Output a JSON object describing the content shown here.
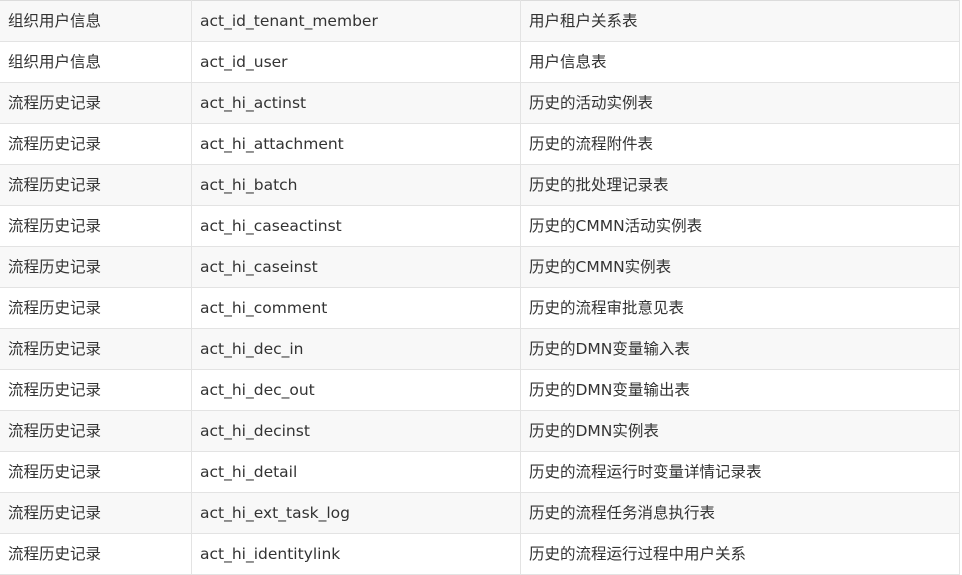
{
  "table": {
    "rows": [
      {
        "category": "组织用户信息",
        "name": "act_id_tenant_member",
        "desc": "用户租户关系表"
      },
      {
        "category": "组织用户信息",
        "name": "act_id_user",
        "desc": "用户信息表"
      },
      {
        "category": "流程历史记录",
        "name": "act_hi_actinst",
        "desc": "历史的活动实例表"
      },
      {
        "category": "流程历史记录",
        "name": "act_hi_attachment",
        "desc": "历史的流程附件表"
      },
      {
        "category": "流程历史记录",
        "name": "act_hi_batch",
        "desc": "历史的批处理记录表"
      },
      {
        "category": "流程历史记录",
        "name": "act_hi_caseactinst",
        "desc": "历史的CMMN活动实例表"
      },
      {
        "category": "流程历史记录",
        "name": "act_hi_caseinst",
        "desc": "历史的CMMN实例表"
      },
      {
        "category": "流程历史记录",
        "name": "act_hi_comment",
        "desc": "历史的流程审批意见表"
      },
      {
        "category": "流程历史记录",
        "name": "act_hi_dec_in",
        "desc": "历史的DMN变量输入表"
      },
      {
        "category": "流程历史记录",
        "name": "act_hi_dec_out",
        "desc": "历史的DMN变量输出表"
      },
      {
        "category": "流程历史记录",
        "name": "act_hi_decinst",
        "desc": "历史的DMN实例表"
      },
      {
        "category": "流程历史记录",
        "name": "act_hi_detail",
        "desc": "历史的流程运行时变量详情记录表"
      },
      {
        "category": "流程历史记录",
        "name": "act_hi_ext_task_log",
        "desc": "历史的流程任务消息执行表"
      },
      {
        "category": "流程历史记录",
        "name": "act_hi_identitylink",
        "desc": "历史的流程运行过程中用户关系"
      }
    ]
  }
}
